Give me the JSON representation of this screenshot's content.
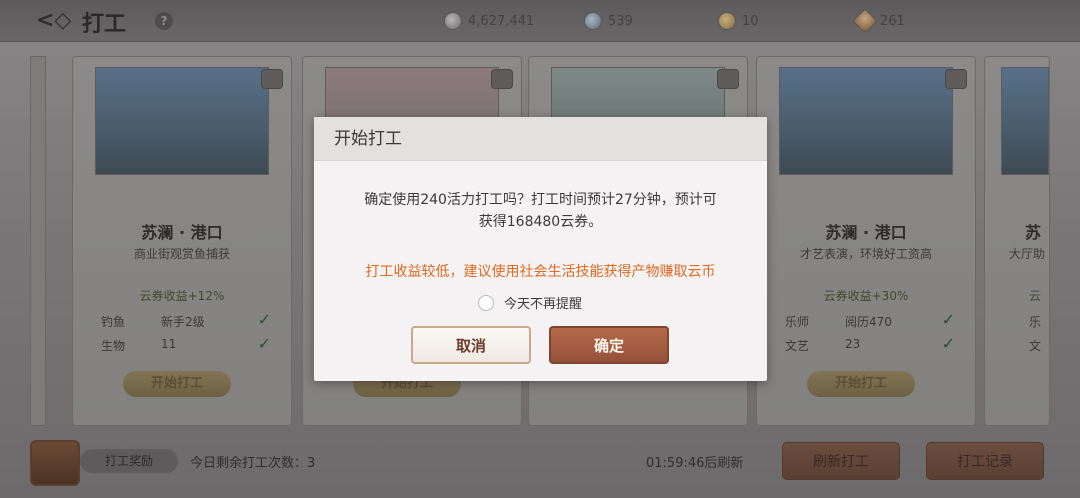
{
  "header": {
    "title": "打工",
    "help": "?",
    "currencies": [
      {
        "icon": "silver-coin-icon",
        "value": "4,627,441"
      },
      {
        "icon": "gem-icon",
        "value": "539"
      },
      {
        "icon": "gold-coin-icon",
        "value": "10"
      },
      {
        "icon": "star-token-icon",
        "value": "261"
      }
    ]
  },
  "cards": [
    {
      "name": "苏澜 · 港口",
      "desc": "商业街观赏鱼捕获",
      "bonus": "云券收益+12%",
      "reqs": [
        {
          "k": "钓鱼",
          "v": "新手2级"
        },
        {
          "k": "生物",
          "v": "11"
        }
      ],
      "start": "开始打工"
    },
    {
      "name": "",
      "desc": "",
      "bonus": "",
      "reqs": [],
      "start": "开始打工"
    },
    {
      "name": "",
      "desc": "",
      "bonus": "",
      "reqs": [],
      "start": ""
    },
    {
      "name": "苏澜 · 港口",
      "desc": "才艺表演，环境好工资高",
      "bonus": "云券收益+30%",
      "reqs": [
        {
          "k": "乐师",
          "v": "阅历470"
        },
        {
          "k": "文艺",
          "v": "23"
        }
      ],
      "start": "开始打工"
    },
    {
      "name": "苏",
      "desc": "大厅助",
      "bonus": "云",
      "reqs": [
        {
          "k": "乐",
          "v": ""
        },
        {
          "k": "文",
          "v": ""
        }
      ],
      "start": ""
    }
  ],
  "bottom": {
    "reward": "打工奖励",
    "remaining": "今日剩余打工次数：3",
    "refresh_time": "01:59:46后刷新",
    "refresh_btn": "刷新打工",
    "record_btn": "打工记录"
  },
  "modal": {
    "title": "开始打工",
    "message_line1": "确定使用240活力打工吗？打工时间预计27分钟，预计可",
    "message_line2": "获得168480云券。",
    "warning": "打工收益较低，建议使用社会生活技能获得产物赚取云币",
    "remind": "今天不再提醒",
    "cancel": "取消",
    "confirm": "确定"
  }
}
